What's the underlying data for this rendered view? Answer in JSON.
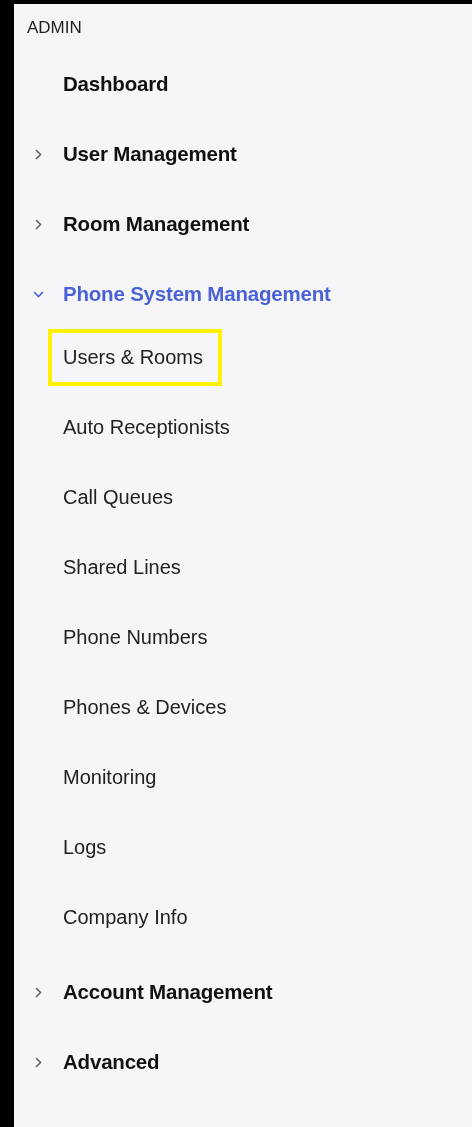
{
  "sidebar": {
    "heading": "ADMIN",
    "items": [
      {
        "label": "Dashboard",
        "kind": "link",
        "selected": false
      },
      {
        "label": "User Management",
        "kind": "group",
        "expanded": false,
        "selected": false
      },
      {
        "label": "Room Management",
        "kind": "group",
        "expanded": false,
        "selected": false
      },
      {
        "label": "Phone System Management",
        "kind": "group",
        "expanded": true,
        "selected": true,
        "children": [
          {
            "label": "Users & Rooms",
            "highlighted": true
          },
          {
            "label": "Auto Receptionists",
            "highlighted": false
          },
          {
            "label": "Call Queues",
            "highlighted": false
          },
          {
            "label": "Shared Lines",
            "highlighted": false
          },
          {
            "label": "Phone Numbers",
            "highlighted": false
          },
          {
            "label": "Phones & Devices",
            "highlighted": false
          },
          {
            "label": "Monitoring",
            "highlighted": false
          },
          {
            "label": "Logs",
            "highlighted": false
          },
          {
            "label": "Company Info",
            "highlighted": false
          }
        ]
      },
      {
        "label": "Account Management",
        "kind": "group",
        "expanded": false,
        "selected": false
      },
      {
        "label": "Advanced",
        "kind": "group",
        "expanded": false,
        "selected": false
      }
    ]
  }
}
